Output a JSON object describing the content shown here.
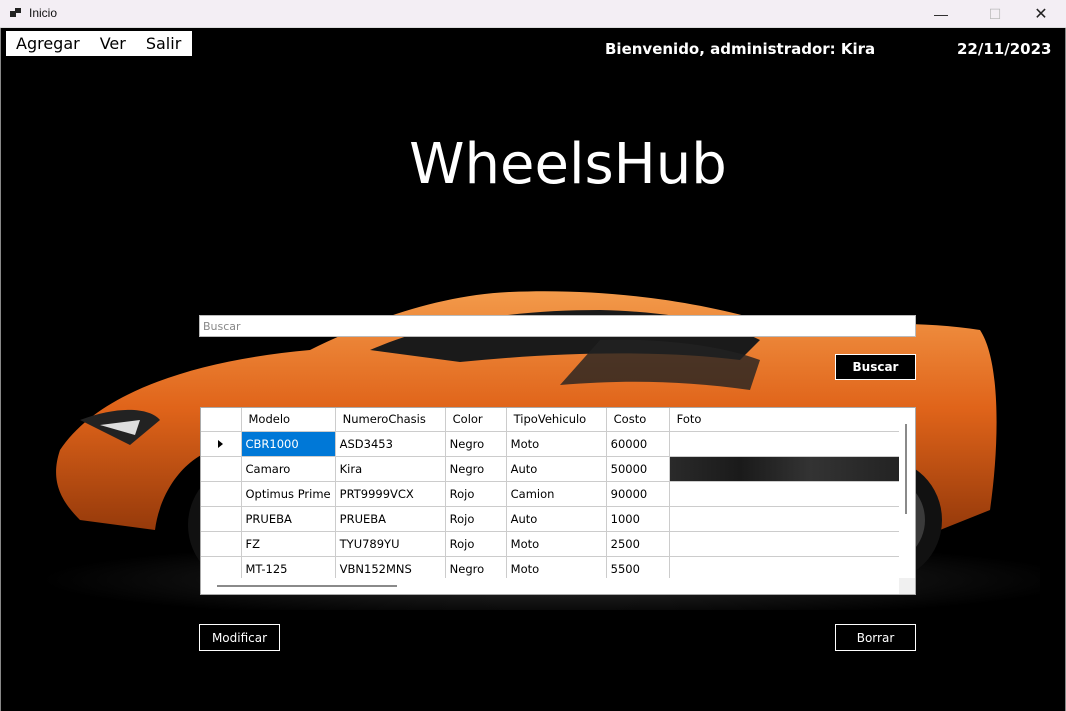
{
  "window": {
    "title": "Inicio",
    "minimize_glyph": "—",
    "maximize_glyph": "☐",
    "close_glyph": "✕"
  },
  "menu": {
    "items": [
      "Agregar",
      "Ver",
      "Salir"
    ]
  },
  "header": {
    "welcome": "Bienvenido, administrador: Kira",
    "date": "22/11/2023"
  },
  "app_title": "WheelsHub",
  "search": {
    "placeholder": "Buscar",
    "button_label": "Buscar"
  },
  "grid": {
    "columns": [
      "Modelo",
      "NumeroChasis",
      "Color",
      "TipoVehiculo",
      "Costo",
      "Foto"
    ],
    "rows": [
      [
        "CBR1000",
        "ASD3453",
        "Negro",
        "Moto",
        "60000",
        ""
      ],
      [
        "Camaro",
        "Kira",
        "Negro",
        "Auto",
        "50000",
        ""
      ],
      [
        "Optimus Prime",
        "PRT9999VCX",
        "Rojo",
        "Camion",
        "90000",
        ""
      ],
      [
        "PRUEBA",
        "PRUEBA",
        "Rojo",
        "Auto",
        "1000",
        ""
      ],
      [
        "FZ",
        "TYU789YU",
        "Rojo",
        "Moto",
        "2500",
        ""
      ],
      [
        "MT-125",
        "VBN152MNS",
        "Negro",
        "Moto",
        "5500",
        ""
      ]
    ],
    "selected_row": 0
  },
  "actions": {
    "modify_label": "Modificar",
    "delete_label": "Borrar"
  },
  "colors": {
    "selection": "#0078d7",
    "car_orange": "#e0641a",
    "background": "#000000"
  }
}
